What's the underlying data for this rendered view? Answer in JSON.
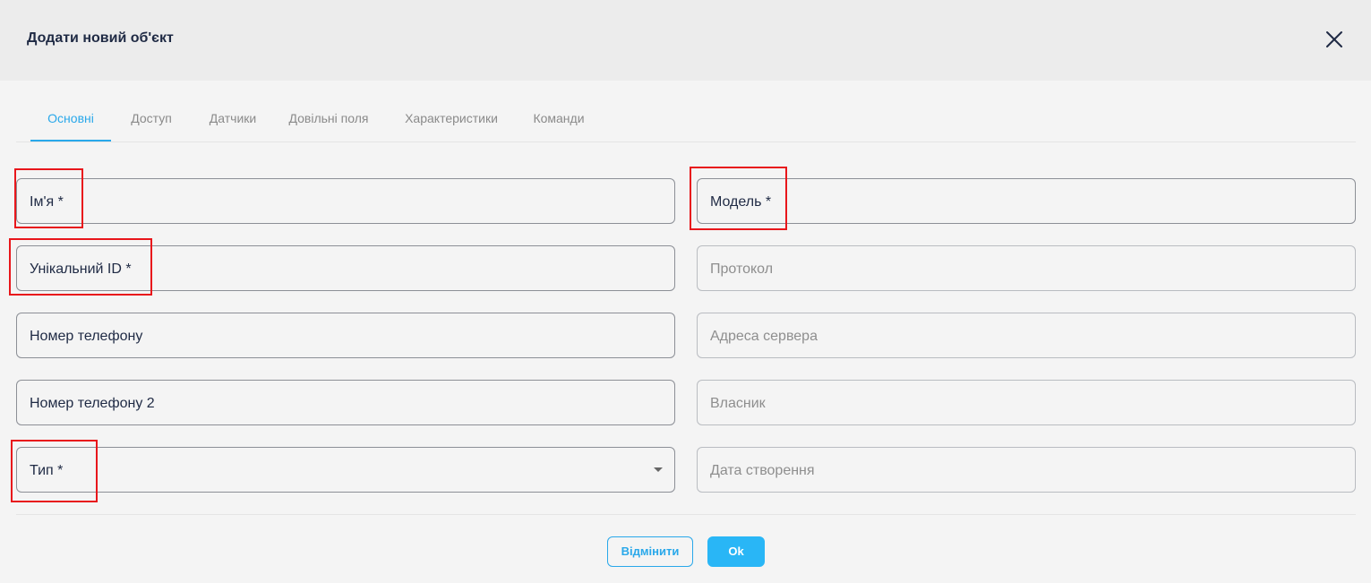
{
  "dialog": {
    "title": "Додати новий об'єкт"
  },
  "tabs": [
    {
      "label": "Основні",
      "active": true
    },
    {
      "label": "Доступ",
      "active": false
    },
    {
      "label": "Датчики",
      "active": false
    },
    {
      "label": "Довільні поля",
      "active": false
    },
    {
      "label": "Характеристики",
      "active": false
    },
    {
      "label": "Команди",
      "active": false
    }
  ],
  "form": {
    "left": [
      {
        "label": "Ім'я *",
        "required": true
      },
      {
        "label": "Унікальний ID *",
        "required": true
      },
      {
        "label": "Номер телефону",
        "required": false
      },
      {
        "label": "Номер телефону 2",
        "required": false
      },
      {
        "label": "Тип *",
        "required": true,
        "type": "select"
      }
    ],
    "right": [
      {
        "label": "Модель *",
        "required": true
      },
      {
        "label": "Протокол",
        "required": false,
        "disabled": true
      },
      {
        "label": "Адреса сервера",
        "required": false,
        "disabled": true
      },
      {
        "label": "Власник",
        "required": false,
        "disabled": true
      },
      {
        "label": "Дата створення",
        "required": false,
        "disabled": true
      }
    ]
  },
  "buttons": {
    "cancel": "Відмінити",
    "ok": "Ok"
  },
  "colors": {
    "accent": "#29a8ea",
    "primary_button": "#29b6f6",
    "highlight": "#e8161b",
    "title": "#1f2a44"
  },
  "icons": {
    "close": "close-icon",
    "dropdown": "caret-down-icon"
  }
}
